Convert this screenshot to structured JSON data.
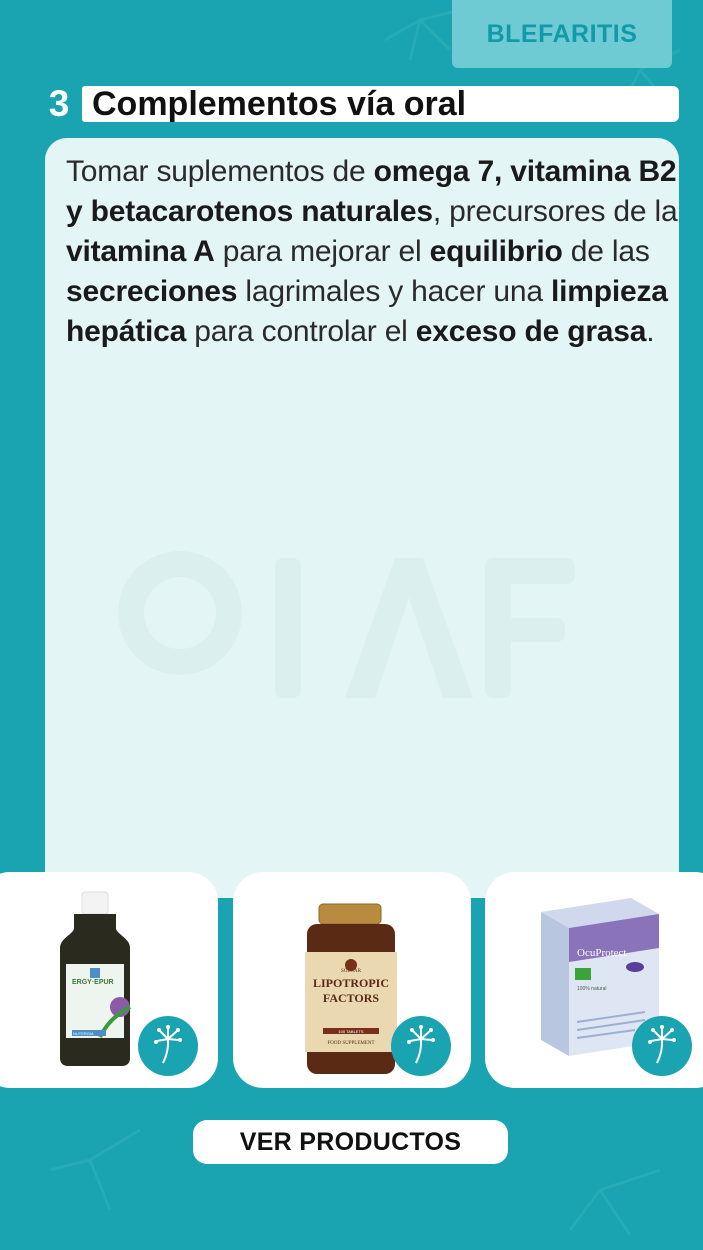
{
  "category_tab": "BLEFARITIS",
  "section": {
    "number": "3",
    "title": "Complementos vía oral"
  },
  "body_segments": [
    {
      "text": "Tomar suplementos de ",
      "bold": false
    },
    {
      "text": "omega 7, vitamina B2 y betacarotenos naturales",
      "bold": true
    },
    {
      "text": ", precursores de la ",
      "bold": false
    },
    {
      "text": "vitamina  A",
      "bold": true
    },
    {
      "text": " para mejorar el ",
      "bold": false
    },
    {
      "text": "equilibrio",
      "bold": true
    },
    {
      "text": " de las ",
      "bold": false
    },
    {
      "text": "secreciones",
      "bold": true
    },
    {
      "text": " lagrimales y hacer una ",
      "bold": false
    },
    {
      "text": "limpieza hepática",
      "bold": true
    },
    {
      "text": " para controlar el ",
      "bold": false
    },
    {
      "text": "exceso de grasa",
      "bold": true
    },
    {
      "text": ".",
      "bold": false
    }
  ],
  "products": [
    {
      "label_brand": "ERGY·EPUR",
      "label_maker": "NUTERGIA",
      "icon": "dandelion-icon"
    },
    {
      "label_brand": "SOLGAR",
      "label_line1": "LIPOTROPIC",
      "label_line2": "FACTORS",
      "label_sub": "100 TABLETS",
      "label_foot": "FOOD SUPPLEMENT",
      "icon": "dandelion-icon"
    },
    {
      "label_brand": "OcuProtect",
      "label_maker": "100% natural",
      "icon": "dandelion-icon"
    }
  ],
  "cta_label": "VER PRODUCTOS",
  "colors": {
    "background": "#1aa3b0",
    "tab": "#6fcbd3",
    "card": "#e4f5f5",
    "badge": "#1aa3b0"
  }
}
